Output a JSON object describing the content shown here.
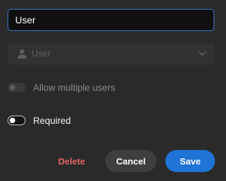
{
  "name_field": {
    "value": "User"
  },
  "user_select": {
    "placeholder": "User",
    "icon": "user-icon"
  },
  "toggles": {
    "allow_multiple": {
      "label": "Allow multiple users",
      "on": false,
      "disabled": true
    },
    "required": {
      "label": "Required",
      "on": false,
      "disabled": false
    }
  },
  "actions": {
    "delete_label": "Delete",
    "cancel_label": "Cancel",
    "save_label": "Save"
  },
  "colors": {
    "background": "#2a2a2a",
    "accent": "#1f74d6",
    "focus_border": "#3b7bd4",
    "danger": "#e56363"
  }
}
